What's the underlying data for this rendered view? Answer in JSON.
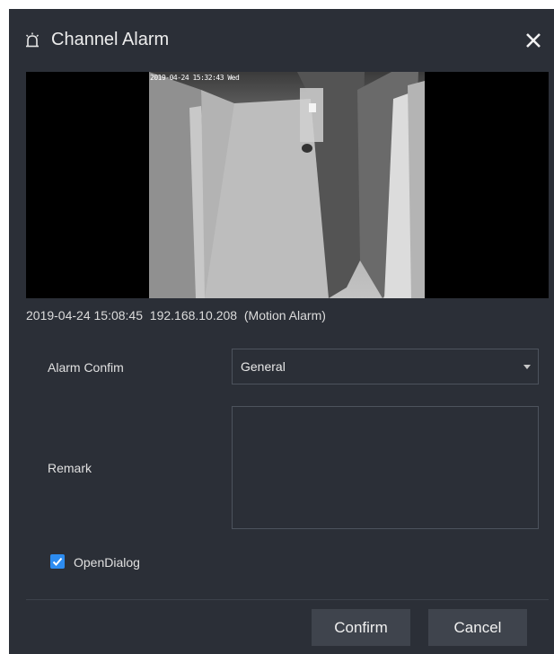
{
  "dialog": {
    "title": "Channel Alarm",
    "title_icon": "alarm-bell-icon",
    "close_icon": "close-icon"
  },
  "video": {
    "osd_timestamp": "2019-04-24 15:32:43 Wed"
  },
  "info_line": "2019-04-24 15:08:45  192.168.10.208  (Motion Alarm)",
  "form": {
    "alarm_confirm_label": "Alarm Confim",
    "alarm_confirm_value": "General",
    "remark_label": "Remark",
    "remark_value": "",
    "open_dialog_label": "OpenDialog",
    "open_dialog_checked": true
  },
  "buttons": {
    "confirm": "Confirm",
    "cancel": "Cancel"
  },
  "colors": {
    "background": "#2b2f37",
    "accent": "#2d8cf0",
    "button": "#3f444d"
  }
}
